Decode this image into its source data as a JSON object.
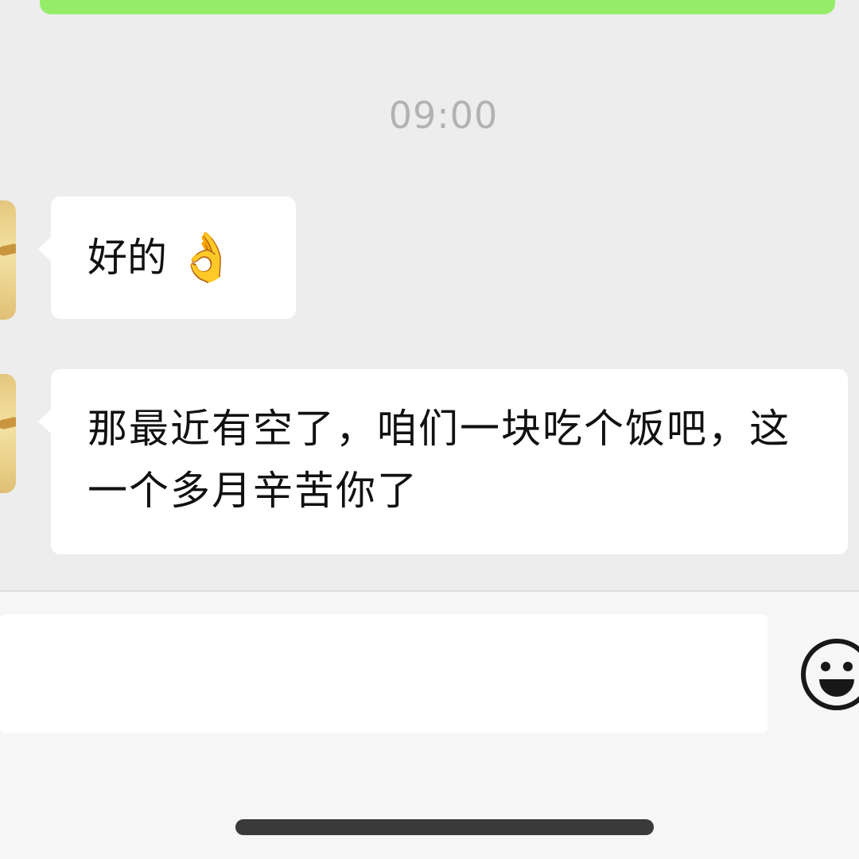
{
  "chat": {
    "timestamp": "09:00",
    "messages": [
      {
        "sender": "other",
        "text": "好的",
        "emoji": "👌"
      },
      {
        "sender": "other",
        "text": "那最近有空了，咱们一块吃个饭吧，这一个多月辛苦你了"
      }
    ]
  },
  "input": {
    "value": "",
    "emoji_icon": "smiley-face-icon"
  },
  "colors": {
    "background": "#ededed",
    "sent_bubble": "#95ec69",
    "received_bubble": "#ffffff",
    "timestamp_text": "#b2b2b2"
  }
}
